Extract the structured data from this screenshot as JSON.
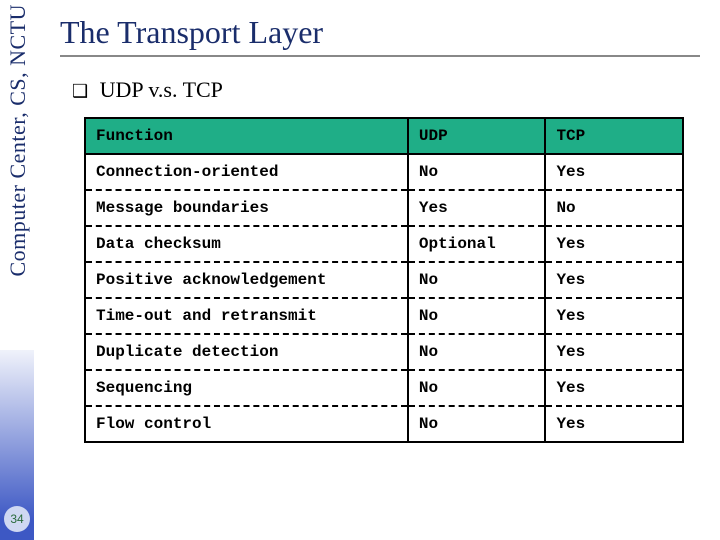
{
  "sidebar": {
    "org_text": "Computer Center, CS, NCTU",
    "page_number": "34"
  },
  "title": "The Transport Layer",
  "subhead": "UDP v.s. TCP",
  "chart_data": {
    "type": "table",
    "title": "UDP v.s. TCP",
    "columns": [
      "Function",
      "UDP",
      "TCP"
    ],
    "rows": [
      {
        "function": "Connection-oriented",
        "udp": "No",
        "tcp": "Yes"
      },
      {
        "function": "Message boundaries",
        "udp": "Yes",
        "tcp": "No"
      },
      {
        "function": "Data checksum",
        "udp": "Optional",
        "tcp": "Yes"
      },
      {
        "function": "Positive acknowledgement",
        "udp": "No",
        "tcp": "Yes"
      },
      {
        "function": "Time-out and retransmit",
        "udp": "No",
        "tcp": "Yes"
      },
      {
        "function": "Duplicate detection",
        "udp": "No",
        "tcp": "Yes"
      },
      {
        "function": "Sequencing",
        "udp": "No",
        "tcp": "Yes"
      },
      {
        "function": "Flow control",
        "udp": "No",
        "tcp": "Yes"
      }
    ]
  }
}
